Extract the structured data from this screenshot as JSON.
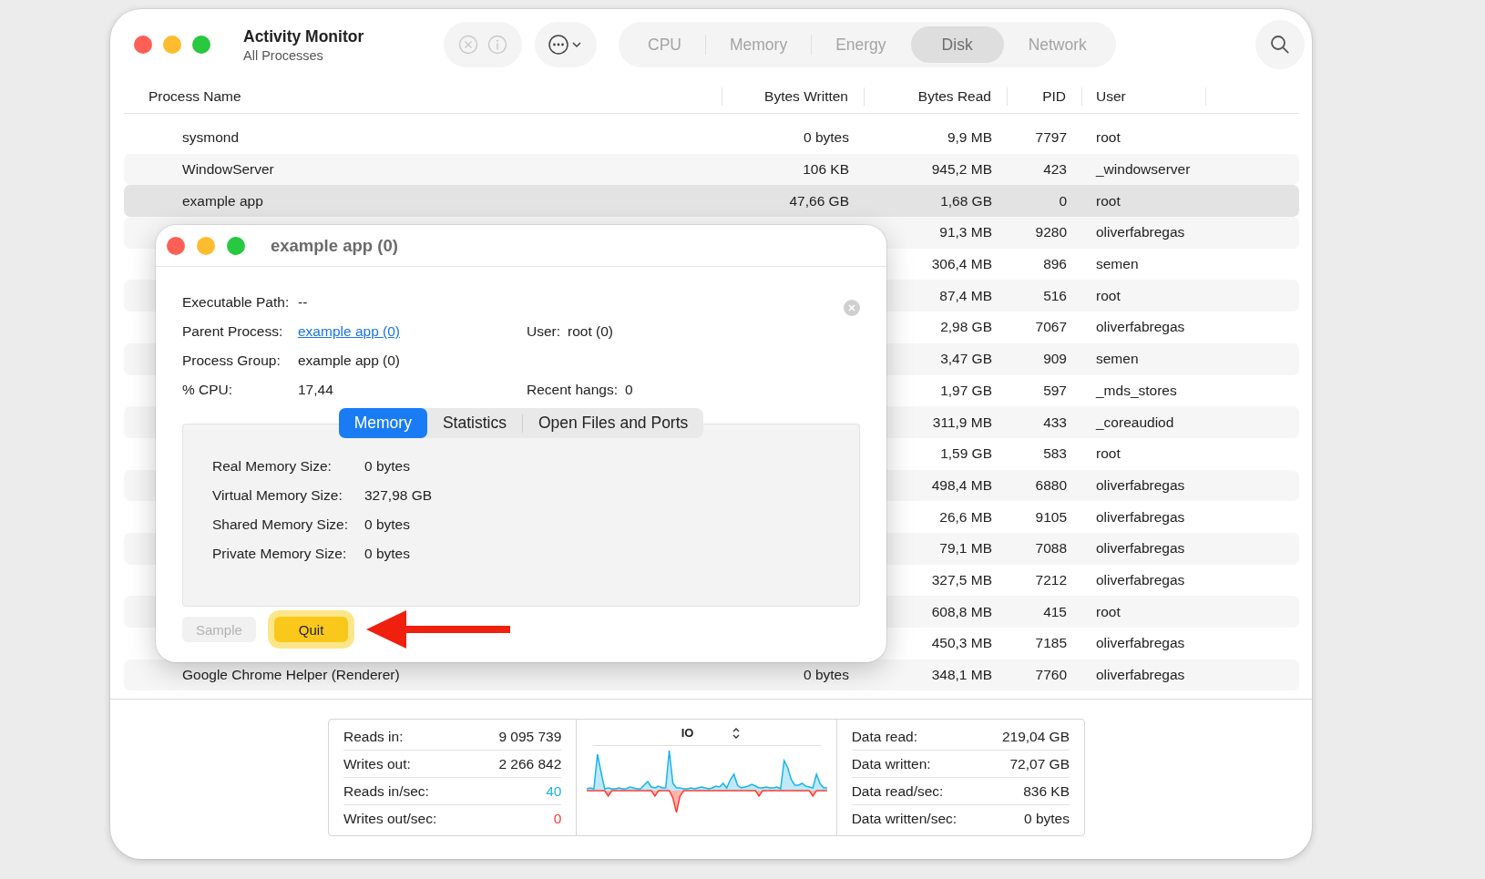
{
  "window": {
    "title": "Activity Monitor",
    "subtitle": "All Processes"
  },
  "toolbar": {
    "buttons": [
      {
        "kind": "stop",
        "disabled": true
      },
      {
        "kind": "info",
        "disabled": true
      },
      {
        "kind": "more",
        "disabled": false
      }
    ]
  },
  "tabs": [
    {
      "label": "CPU",
      "selected": false
    },
    {
      "label": "Memory",
      "selected": false
    },
    {
      "label": "Energy",
      "selected": false
    },
    {
      "label": "Disk",
      "selected": true
    },
    {
      "label": "Network",
      "selected": false
    }
  ],
  "table": {
    "columns": [
      "Process Name",
      "Bytes Written",
      "Bytes Read",
      "PID",
      "User"
    ],
    "rows": [
      {
        "name": "sysmond",
        "bytes_written": "0 bytes",
        "bytes_read": "9,9 MB",
        "pid": "7797",
        "user": "root",
        "selected": false
      },
      {
        "name": "WindowServer",
        "bytes_written": "106 KB",
        "bytes_read": "945,2 MB",
        "pid": "423",
        "user": "_windowserver",
        "selected": false
      },
      {
        "name": "example app",
        "bytes_written": "47,66 GB",
        "bytes_read": "1,68 GB",
        "pid": "0",
        "user": "root",
        "selected": true
      },
      {
        "bytes_read": "91,3 MB",
        "pid": "9280",
        "user": "oliverfabregas",
        "selected": false
      },
      {
        "bytes_read": "306,4 MB",
        "pid": "896",
        "user": "semen",
        "selected": false
      },
      {
        "bytes_read": "87,4 MB",
        "pid": "516",
        "user": "root",
        "selected": false
      },
      {
        "bytes_read": "2,98 GB",
        "pid": "7067",
        "user": "oliverfabregas",
        "selected": false
      },
      {
        "bytes_read": "3,47 GB",
        "pid": "909",
        "user": "semen",
        "selected": false
      },
      {
        "bytes_read": "1,97 GB",
        "pid": "597",
        "user": "_mds_stores",
        "selected": false
      },
      {
        "bytes_read": "311,9 MB",
        "pid": "433",
        "user": "_coreaudiod",
        "selected": false
      },
      {
        "bytes_read": "1,59 GB",
        "pid": "583",
        "user": "root",
        "selected": false
      },
      {
        "bytes_read": "498,4 MB",
        "pid": "6880",
        "user": "oliverfabregas",
        "selected": false
      },
      {
        "bytes_read": "26,6 MB",
        "pid": "9105",
        "user": "oliverfabregas",
        "selected": false
      },
      {
        "bytes_read": "79,1 MB",
        "pid": "7088",
        "user": "oliverfabregas",
        "selected": false
      },
      {
        "bytes_read": "327,5 MB",
        "pid": "7212",
        "user": "oliverfabregas",
        "selected": false
      },
      {
        "bytes_read": "608,8 MB",
        "pid": "415",
        "user": "root",
        "selected": false
      },
      {
        "bytes_read": "450,3 MB",
        "pid": "7185",
        "user": "oliverfabregas",
        "selected": false
      },
      {
        "name": "Google Chrome Helper (Renderer)",
        "bytes_written": "0 bytes",
        "bytes_read": "348,1 MB",
        "pid": "7760",
        "user": "oliverfabregas",
        "selected": false
      }
    ]
  },
  "dialog": {
    "title": "example app (0)",
    "info_rows": [
      [
        {
          "label": "Executable Path:",
          "value": "--"
        }
      ],
      [
        {
          "label": "Parent Process:",
          "value": "example app (0)",
          "kind": "link"
        },
        {
          "label": "User:",
          "value": "root (0)"
        }
      ],
      [
        {
          "label": "Process Group:",
          "value": "example app (0)"
        }
      ],
      [
        {
          "label": "% CPU:",
          "value": "17,44"
        },
        {
          "label": "Recent hangs:",
          "value": "0"
        }
      ]
    ],
    "tabs": [
      {
        "label": "Memory",
        "selected": true
      },
      {
        "label": "Statistics",
        "selected": false
      },
      {
        "label": "Open Files and Ports",
        "selected": false
      }
    ],
    "memory": [
      {
        "label": "Real Memory Size:",
        "value": "0 bytes"
      },
      {
        "label": "Virtual Memory Size:",
        "value": "327,98 GB"
      },
      {
        "label": "Shared Memory Size:",
        "value": "0 bytes"
      },
      {
        "label": "Private Memory Size:",
        "value": "0 bytes"
      }
    ],
    "buttons": [
      {
        "label": "Sample",
        "disabled": true,
        "highlighted": false
      },
      {
        "label": "Quit",
        "disabled": false,
        "highlighted": true
      }
    ]
  },
  "stats": {
    "left": [
      {
        "label": "Reads in:",
        "value": "9 095 739"
      },
      {
        "label": "Writes out:",
        "value": "2 266 842"
      },
      {
        "label": "Reads in/sec:",
        "value": "40",
        "color": "#1ab4ec"
      },
      {
        "label": "Writes out/sec:",
        "value": "0",
        "color": "#ff3b30"
      }
    ],
    "chart": {
      "title": "IO"
    },
    "right": [
      {
        "label": "Data read:",
        "value": "219,04 GB"
      },
      {
        "label": "Data written:",
        "value": "72,07 GB"
      },
      {
        "label": "Data read/sec:",
        "value": "836 KB"
      },
      {
        "label": "Data written/sec:",
        "value": "0 bytes"
      }
    ]
  }
}
